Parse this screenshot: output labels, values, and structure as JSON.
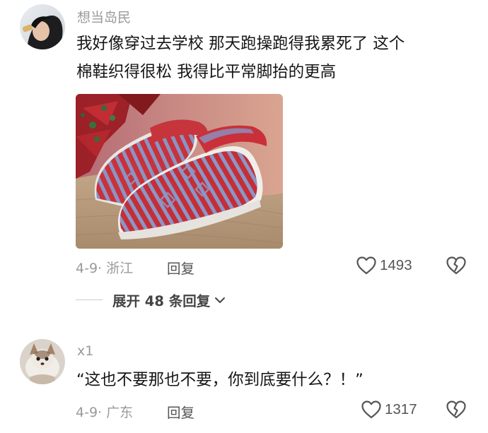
{
  "comments": [
    {
      "username": "想当岛民",
      "text_line1": "我好像穿过去学校 那天跑操跑得我累死了 这个",
      "text_line2": "棉鞋织得很松 我得比平常脚抬的更高",
      "date_location": "4-9· 浙江",
      "reply_label": "回复",
      "likes": "1493",
      "expand_label": "展开 48 条回复"
    },
    {
      "username": "x1",
      "text": "“这也不要那也不要，你到底要什么？！”",
      "date_location": "4-9· 广东",
      "reply_label": "回复",
      "likes": "1317"
    }
  ],
  "colors": {
    "username": "#9a9a9a",
    "body_text": "#161616",
    "meta": "#9a9a9a",
    "slipper_red": "#c8323a",
    "slipper_blue": "#8a94c4"
  },
  "icons": {
    "like": "heart-outline-icon",
    "dislike": "broken-heart-icon",
    "expand": "chevron-down-icon"
  }
}
